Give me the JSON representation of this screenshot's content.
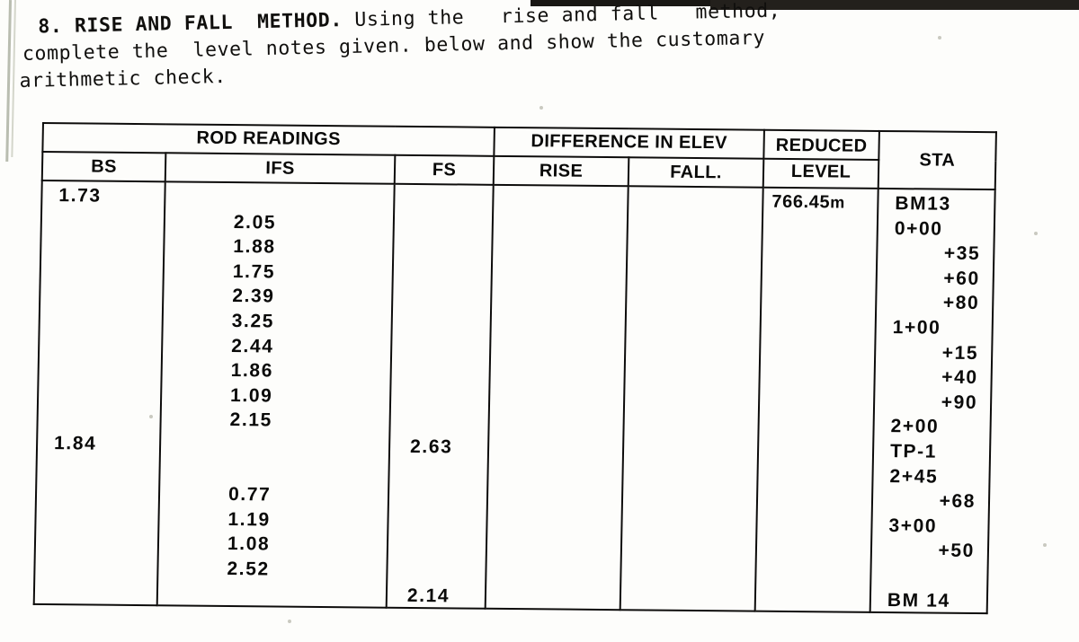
{
  "problem": {
    "number": "8.",
    "title": "RISE AND FALL  METHOD.",
    "line1_rest": " Using the   rise and fall   method,",
    "line2": "complete the  level notes given. below and show the customary",
    "line3": "arithmetic check."
  },
  "table": {
    "group_headers": {
      "rod_readings": "ROD  READINGS",
      "difference_in_elev": "DIFFERENCE IN ELEV",
      "reduced_level_top": "REDUCED",
      "reduced_level_bottom": "LEVEL",
      "sta": "STA"
    },
    "columns": {
      "bs": "BS",
      "ifs": "IFS",
      "fs": "FS",
      "rise": "RISE",
      "fall": "FALL."
    },
    "rows": [
      {
        "bs": "1.73",
        "ifs": "",
        "fs": "",
        "rise": "",
        "fall": "",
        "reduced_level": "766.45 m",
        "sta": "BM13",
        "sta_align": "left"
      },
      {
        "bs": "",
        "ifs": "2.05",
        "fs": "",
        "rise": "",
        "fall": "",
        "reduced_level": "",
        "sta": "0+00",
        "sta_align": "left"
      },
      {
        "bs": "",
        "ifs": "1.88",
        "fs": "",
        "rise": "",
        "fall": "",
        "reduced_level": "",
        "sta": "+35",
        "sta_align": "right"
      },
      {
        "bs": "",
        "ifs": "1.75",
        "fs": "",
        "rise": "",
        "fall": "",
        "reduced_level": "",
        "sta": "+60",
        "sta_align": "right"
      },
      {
        "bs": "",
        "ifs": "2.39",
        "fs": "",
        "rise": "",
        "fall": "",
        "reduced_level": "",
        "sta": "+80",
        "sta_align": "right"
      },
      {
        "bs": "",
        "ifs": "3.25",
        "fs": "",
        "rise": "",
        "fall": "",
        "reduced_level": "",
        "sta": "1+00",
        "sta_align": "left"
      },
      {
        "bs": "",
        "ifs": "2.44",
        "fs": "",
        "rise": "",
        "fall": "",
        "reduced_level": "",
        "sta": "+15",
        "sta_align": "right"
      },
      {
        "bs": "",
        "ifs": "1.86",
        "fs": "",
        "rise": "",
        "fall": "",
        "reduced_level": "",
        "sta": "+40",
        "sta_align": "right"
      },
      {
        "bs": "",
        "ifs": "1.09",
        "fs": "",
        "rise": "",
        "fall": "",
        "reduced_level": "",
        "sta": "+90",
        "sta_align": "right"
      },
      {
        "bs": "",
        "ifs": "2.15",
        "fs": "",
        "rise": "",
        "fall": "",
        "reduced_level": "",
        "sta": "2+00",
        "sta_align": "left"
      },
      {
        "bs": "1.84",
        "ifs": "",
        "fs": "2.63",
        "rise": "",
        "fall": "",
        "reduced_level": "",
        "sta": "TP-1",
        "sta_align": "left"
      },
      {
        "bs": "",
        "ifs": "",
        "fs": "",
        "rise": "",
        "fall": "",
        "reduced_level": "",
        "sta": "2+45",
        "sta_align": "left"
      },
      {
        "bs": "",
        "ifs": "0.77",
        "fs": "",
        "rise": "",
        "fall": "",
        "reduced_level": "",
        "sta": "+68",
        "sta_align": "right"
      },
      {
        "bs": "",
        "ifs": "1.19",
        "fs": "",
        "rise": "",
        "fall": "",
        "reduced_level": "",
        "sta": "3+00",
        "sta_align": "left"
      },
      {
        "bs": "",
        "ifs": "1.08",
        "fs": "",
        "rise": "",
        "fall": "",
        "reduced_level": "",
        "sta": "+50",
        "sta_align": "right"
      },
      {
        "bs": "",
        "ifs": "2.52",
        "fs": "",
        "rise": "",
        "fall": "",
        "reduced_level": "",
        "sta": "",
        "sta_align": "right"
      },
      {
        "bs": "",
        "ifs": "",
        "fs": "2.14",
        "rise": "",
        "fall": "",
        "reduced_level": "",
        "sta": "BM 14",
        "sta_align": "left"
      }
    ]
  }
}
